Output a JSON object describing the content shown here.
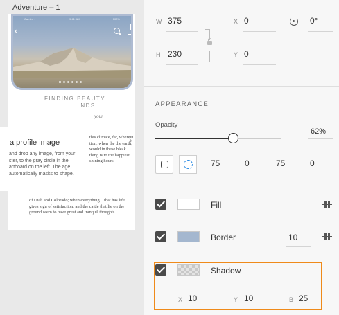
{
  "artboard": {
    "title": "Adventure – 1",
    "status_left": "Carrier ᯤ",
    "status_center": "9:41 AM",
    "status_right": "100%",
    "heading_line1": "FINDING BEAUTY",
    "heading_line2": "NDS",
    "subheading": "your",
    "body_right": "this climate, far, wherein tion, when the  the earth, would in these bleak thing is to the happiest shining hours",
    "body_bottom": "of Utah and Colorado; when everything... that has life gives sign of satisfaction, and the cattle that lie on the ground seem to have great and tranquil thoughts.",
    "tooltip_title": "a profile image",
    "tooltip_body": "and drop any image, from your ster, to the gray circle in the artboard on the left. The age automatically masks to shape."
  },
  "transform": {
    "w_label": "W",
    "w_value": "375",
    "h_label": "H",
    "h_value": "230",
    "x_label": "X",
    "x_value": "0",
    "y_label": "Y",
    "y_value": "0",
    "rotation_value": "0°"
  },
  "appearance": {
    "section_title": "APPEARANCE",
    "opacity_label": "Opacity",
    "opacity_value": "62%",
    "opacity_fraction": 0.62,
    "corner_radius": [
      "75",
      "0",
      "75",
      "0"
    ]
  },
  "fill": {
    "label": "Fill",
    "color": "#ffffff",
    "checked": true
  },
  "border": {
    "label": "Border",
    "color": "#a4b7cf",
    "width": "10",
    "checked": true
  },
  "shadow": {
    "label": "Shadow",
    "checked": true,
    "x_label": "X",
    "x_value": "10",
    "y_label": "Y",
    "y_value": "10",
    "b_label": "B",
    "b_value": "25"
  },
  "colors": {
    "highlight": "#ef8a1a",
    "accent": "#2c8ce5"
  }
}
